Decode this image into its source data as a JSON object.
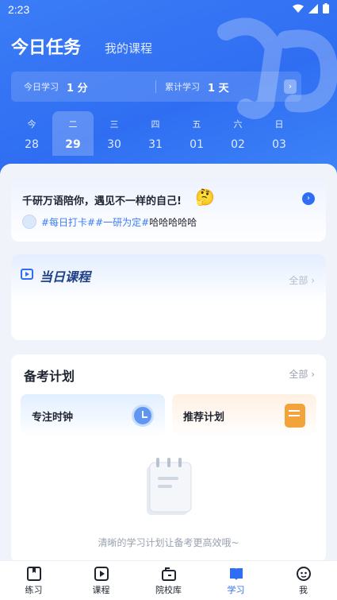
{
  "status": {
    "time": "2:23"
  },
  "header": {
    "tab_active": "今日任务",
    "tab_other": "我的课程"
  },
  "stats": {
    "today_label": "今日学习",
    "today_value": "1 分",
    "total_label": "累计学习",
    "total_value": "1 天",
    "arrow": "›"
  },
  "week": [
    {
      "weekday": "今",
      "date": "28"
    },
    {
      "weekday": "二",
      "date": "29",
      "active": true
    },
    {
      "weekday": "三",
      "date": "30"
    },
    {
      "weekday": "四",
      "date": "31"
    },
    {
      "weekday": "五",
      "date": "01"
    },
    {
      "weekday": "六",
      "date": "02"
    },
    {
      "weekday": "日",
      "date": "03"
    }
  ],
  "motto": {
    "title": "千研万语陪你，遇见不一样的自己!",
    "emoji": "🤔",
    "go": "›",
    "tags": "#每日打卡##一研为定#",
    "text": "哈哈哈哈哈"
  },
  "today_course": {
    "title": "当日课程",
    "all": "全部 ›"
  },
  "plan": {
    "title": "备考计划",
    "all": "全部 ›",
    "focus": "专注时钟",
    "recommend": "推荐计划",
    "empty": "清晰的学习计划让备考更高效哦~"
  },
  "nav": [
    {
      "label": "练习",
      "icon": "practice-icon"
    },
    {
      "label": "课程",
      "icon": "course-icon"
    },
    {
      "label": "院校库",
      "icon": "school-icon"
    },
    {
      "label": "学习",
      "icon": "study-icon",
      "active": true
    },
    {
      "label": "我",
      "icon": "profile-icon"
    }
  ],
  "colors": {
    "primary": "#2f6ef2",
    "accent_orange": "#f3a33b"
  }
}
